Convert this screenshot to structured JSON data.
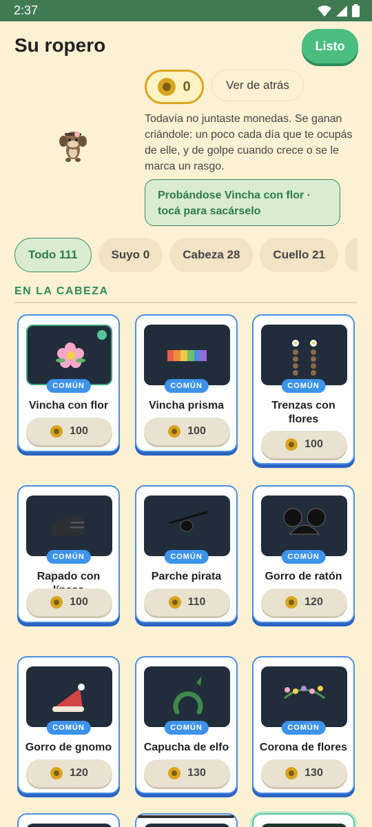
{
  "status": {
    "time": "2:37"
  },
  "header": {
    "title": "Su ropero",
    "done_label": "Listo"
  },
  "coins": {
    "value": "0"
  },
  "back_view_label": "Ver de atrás",
  "description": "Todavía no juntaste monedas. Se ganan criándole: un poco cada día que te ocupás de elle, y de golpe cuando crece o se le marca un rasgo.",
  "trying_on": "Probándose Vincha con flor · tocá para sacárselo",
  "tabs": [
    {
      "label": "Todo 111",
      "active": true
    },
    {
      "label": "Suyo 0",
      "active": false
    },
    {
      "label": "Cabeza 28",
      "active": false
    },
    {
      "label": "Cuello 21",
      "active": false
    },
    {
      "label": "",
      "active": false
    }
  ],
  "section_title": "EN LA CABEZA",
  "items": [
    {
      "name": "Vincha con flor",
      "rarity": "COMÚN",
      "price": "100",
      "selected": true,
      "icon": "flower-icon"
    },
    {
      "name": "Vincha prisma",
      "rarity": "COMÚN",
      "price": "100",
      "selected": false,
      "icon": "rainbow-band-icon"
    },
    {
      "name": "Trenzas con flores",
      "rarity": "COMÚN",
      "price": "100",
      "selected": false,
      "icon": "braids-icon"
    },
    {
      "name": "Rapado con líneas",
      "rarity": "COMÚN",
      "price": "100",
      "selected": false,
      "icon": "shaved-head-icon"
    },
    {
      "name": "Parche pirata",
      "rarity": "COMÚN",
      "price": "110",
      "selected": false,
      "icon": "eyepatch-icon"
    },
    {
      "name": "Gorro de ratón",
      "rarity": "COMÚN",
      "price": "120",
      "selected": false,
      "icon": "mouse-ears-icon"
    },
    {
      "name": "Gorro de gnomo",
      "rarity": "COMÚN",
      "price": "120",
      "selected": false,
      "icon": "gnome-hat-icon"
    },
    {
      "name": "Capucha de elfo",
      "rarity": "COMÚN",
      "price": "130",
      "selected": false,
      "icon": "elf-hood-icon"
    },
    {
      "name": "Corona de flores",
      "rarity": "COMÚN",
      "price": "130",
      "selected": false,
      "icon": "flower-crown-icon"
    }
  ],
  "colors": {
    "accent_green": "#4bbd80",
    "card_border": "#4b8fe0",
    "background": "#fdf1d4"
  }
}
